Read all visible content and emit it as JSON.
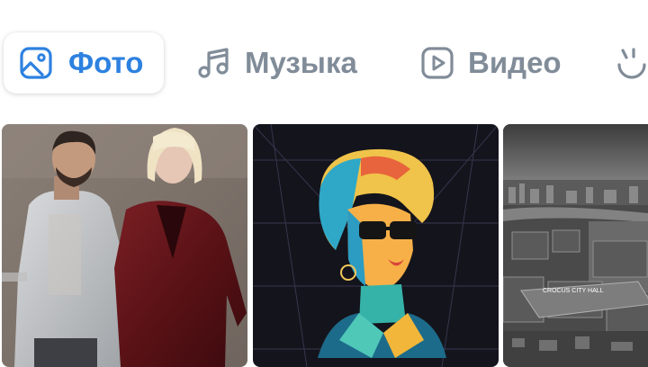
{
  "tabs": [
    {
      "label": "Фото",
      "icon": "image-icon",
      "active": true
    },
    {
      "label": "Музыка",
      "icon": "music-note-icon",
      "active": false
    },
    {
      "label": "Видео",
      "icon": "play-icon",
      "active": false
    },
    {
      "label": "",
      "icon": "clips-icon",
      "active": false
    }
  ],
  "tiles": [
    {
      "kind": "photo",
      "subject": "duo-portrait"
    },
    {
      "kind": "photo",
      "subject": "pop-art-portrait"
    },
    {
      "kind": "photo",
      "subject": "aerial-city"
    }
  ],
  "tile3_sign": "CROCUS CITY HALL",
  "colors": {
    "accent": "#2d81e0",
    "inactive": "#818c99",
    "background": "#ffffff"
  }
}
